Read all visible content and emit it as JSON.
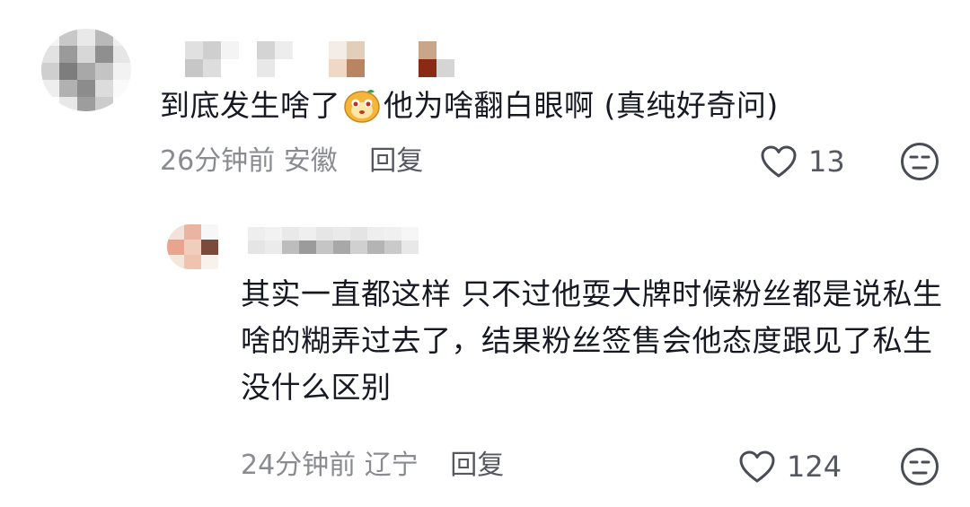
{
  "comments": [
    {
      "text_before_emoji": "到底发生啥了",
      "emoji": "monkey-face-emoji",
      "text_after_emoji": "他为啥翻白眼啊 (真纯好奇问)",
      "time": "26分钟前",
      "location": "安徽",
      "reply_label": "回复",
      "likes": "13",
      "like_icon": "heart-outline-icon",
      "dislike_icon": "unamused-face-icon"
    },
    {
      "text": "其实一直都这样 只不过他耍大牌时候粉丝都是说私生啥的糊弄过去了，结果粉丝签售会他态度跟见了私生没什么区别",
      "time": "24分钟前",
      "location": "辽宁",
      "reply_label": "回复",
      "likes": "124",
      "like_icon": "heart-outline-icon",
      "dislike_icon": "unamused-face-icon"
    }
  ],
  "colors": {
    "text_primary": "#161823",
    "text_meta": "#8a8b91",
    "text_secondary": "#565861"
  }
}
